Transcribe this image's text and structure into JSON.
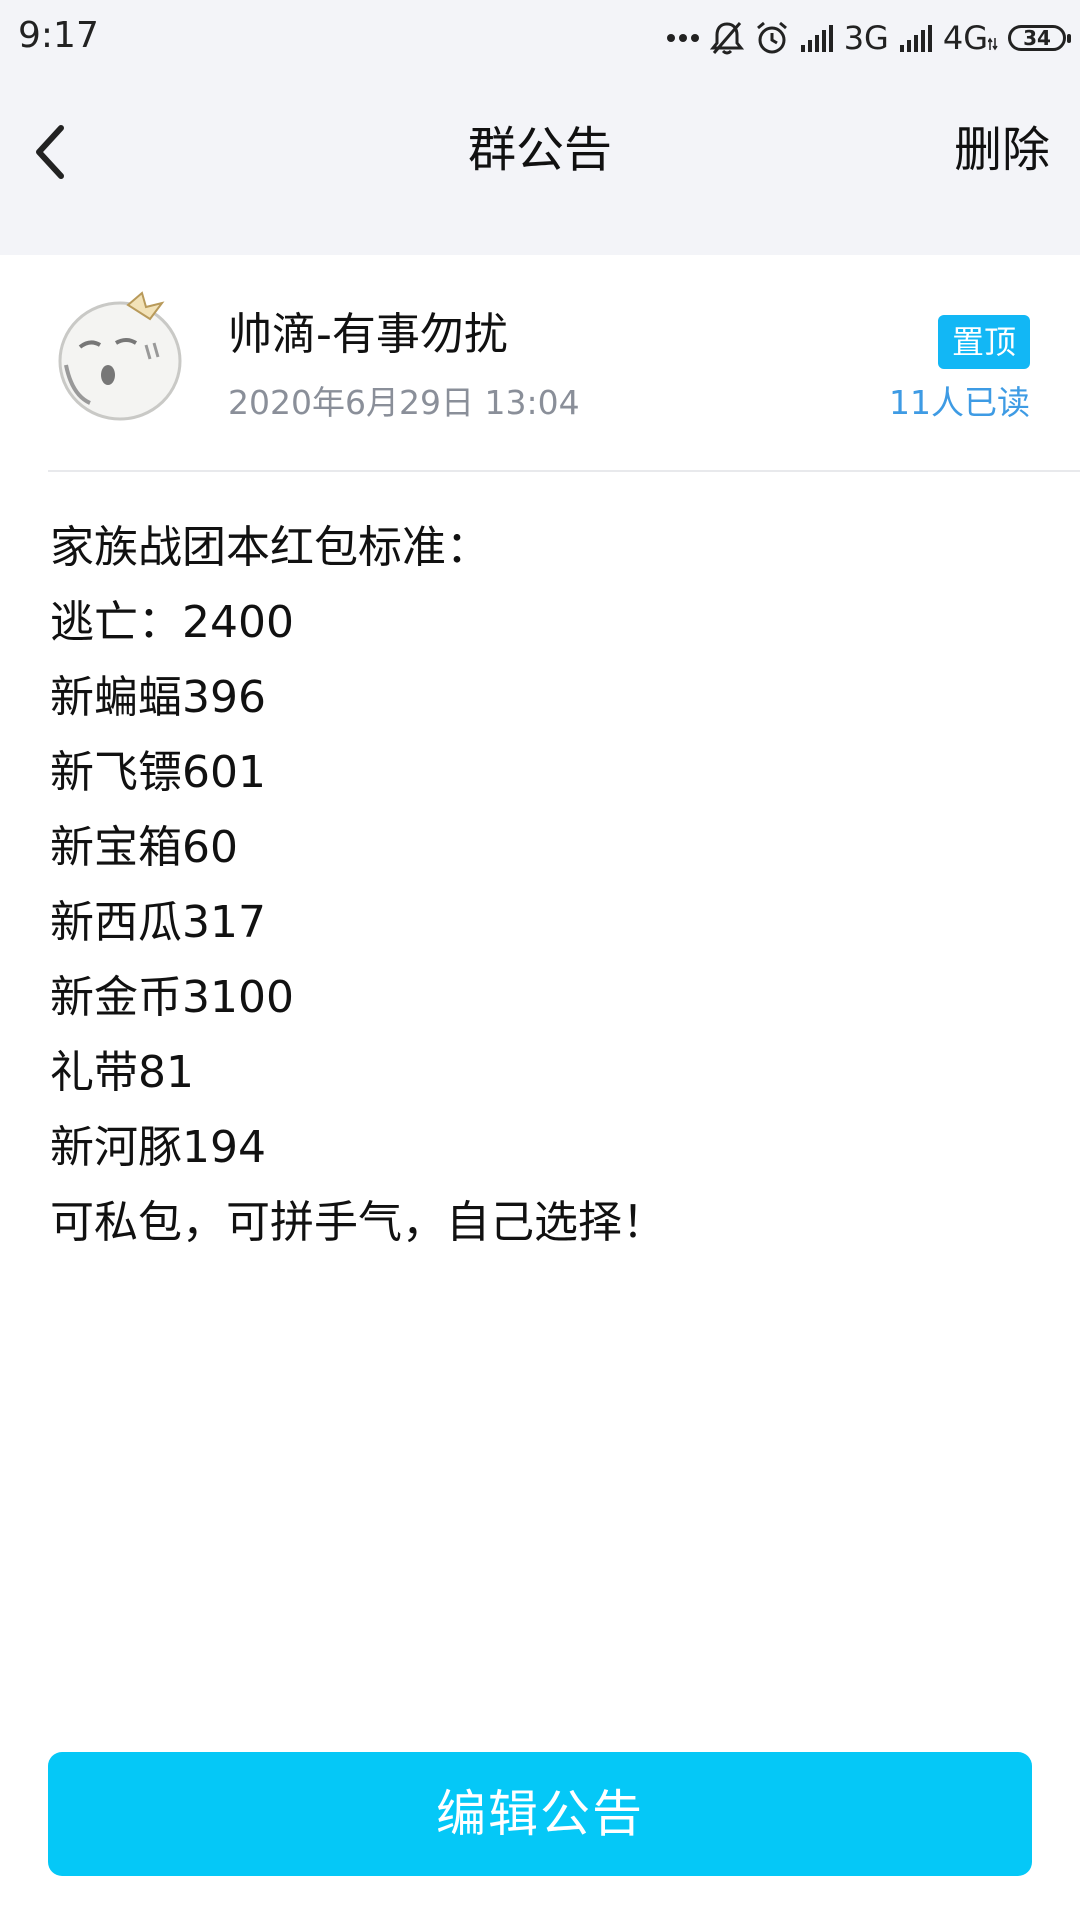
{
  "status_bar": {
    "time": "9:17",
    "network_3g": "3G",
    "network_4g": "4G",
    "battery": "34",
    "icons": [
      "more-dots-icon",
      "muted-bell-icon",
      "alarm-icon",
      "signal-icon",
      "signal-icon",
      "data-arrows-icon",
      "battery-icon"
    ]
  },
  "nav": {
    "title": "群公告",
    "delete_label": "删除",
    "back_icon": "chevron-left-icon"
  },
  "author": {
    "name": "帅滴-有事勿扰",
    "date": "2020年6月29日 13:04",
    "pin_label": "置顶",
    "read_count": "11人已读",
    "avatar_icon": "cartoon-avatar-icon"
  },
  "content": {
    "lines": [
      "家族战团本红包标准：",
      "逃亡：2400",
      "新蝙蝠396",
      "新飞镖601",
      "新宝箱60",
      "新西瓜317",
      "新金币3100",
      "礼带81",
      "新河豚194",
      "可私包，可拼手气，自己选择！"
    ]
  },
  "footer": {
    "edit_label": "编辑公告"
  },
  "colors": {
    "accent": "#05c8f7",
    "badge": "#12b7f5",
    "read_text": "#3e9be4",
    "header_bg": "#f3f4f8"
  }
}
